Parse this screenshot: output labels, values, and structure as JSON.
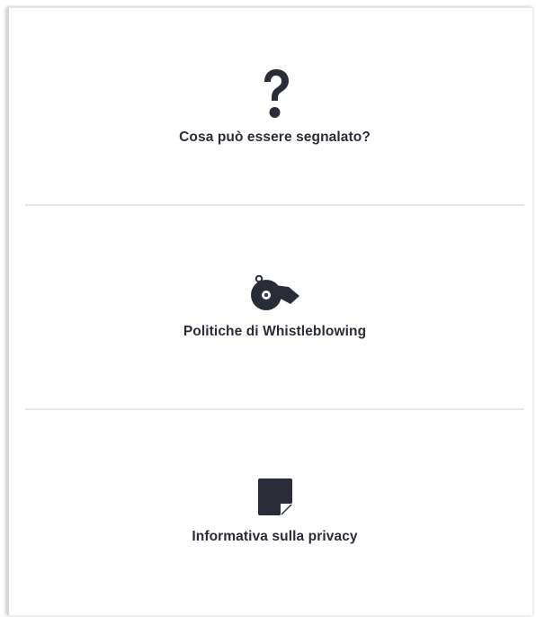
{
  "cards": [
    {
      "icon": "question-mark-icon",
      "label": "Cosa può essere segnalato?"
    },
    {
      "icon": "whistle-icon",
      "label": "Politiche di Whistleblowing"
    },
    {
      "icon": "sticky-note-icon",
      "label": "Informativa sulla privacy"
    }
  ],
  "colors": {
    "icon": "#2a2d37",
    "text": "#2a2d37",
    "divider": "#e8e8e8",
    "background": "#ffffff"
  }
}
